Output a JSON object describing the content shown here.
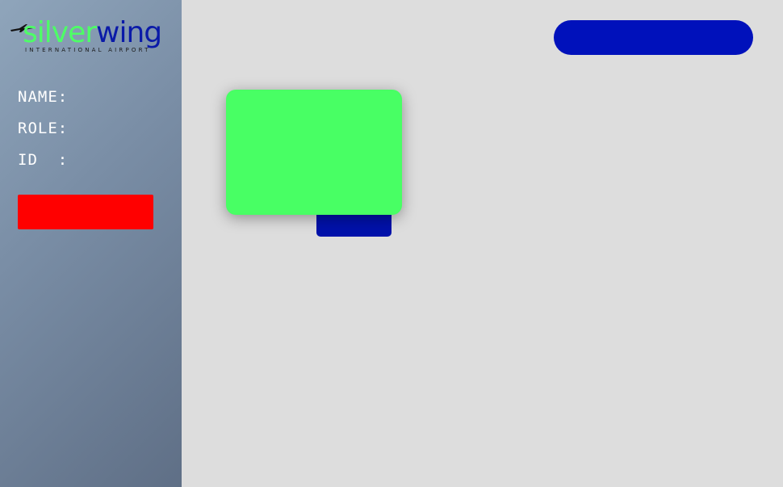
{
  "logo": {
    "brand_part1": "silver",
    "brand_part2": "wing",
    "subtitle": "INTERNATIONAL AIRPORT",
    "plane_icon": "airplane-icon"
  },
  "user_info": {
    "name_label": "NAME:",
    "role_label": "ROLE:",
    "id_label": "ID  :"
  },
  "colors": {
    "sidebar_gradient_start": "#8fa5bb",
    "sidebar_gradient_end": "#5f6f86",
    "main_background": "#dddddd",
    "logout_button": "#ff0000",
    "top_button": "#0011bb",
    "card": "#48ff64",
    "card_tab": "#0011aa"
  }
}
